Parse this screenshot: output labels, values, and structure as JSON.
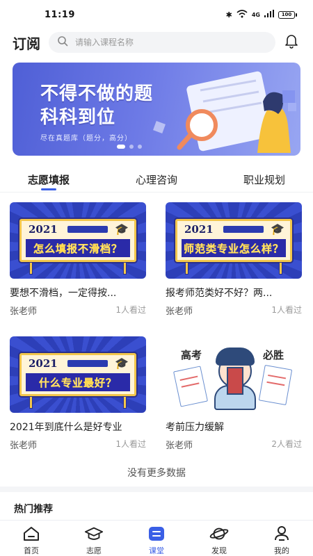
{
  "status": {
    "time": "11:19",
    "battery": "100",
    "signal": "4G"
  },
  "header": {
    "title": "订阅",
    "search_placeholder": "请输入课程名称"
  },
  "banner": {
    "line1": "不得不做的题",
    "line2": "科科到位",
    "subtitle": "尽在真题库（题分，高分）"
  },
  "tabs": [
    {
      "label": "志愿填报",
      "active": true
    },
    {
      "label": "心理咨询",
      "active": false
    },
    {
      "label": "职业规划",
      "active": false
    }
  ],
  "cards": [
    {
      "sign_year": "2021",
      "sign_text": "怎么填报不滑档？",
      "title": "要想不滑档，一定得按...",
      "teacher": "张老师",
      "views": "1人看过"
    },
    {
      "sign_year": "2021",
      "sign_text": "师范类专业怎么样？",
      "title": "报考师范类好不好？两...",
      "teacher": "张老师",
      "views": "1人看过"
    },
    {
      "sign_year": "2021",
      "sign_text": "什么专业最好？",
      "title": "2021年到底什么是好专业",
      "teacher": "张老师",
      "views": "1人看过"
    },
    {
      "art_left": "高考",
      "art_right": "必胜",
      "title": "考前压力缓解",
      "teacher": "张老师",
      "views": "2人看过"
    }
  ],
  "no_more": "没有更多数据",
  "hot_title": "热门推荐",
  "nav": [
    {
      "label": "首页",
      "icon": "home-icon",
      "active": false
    },
    {
      "label": "志愿",
      "icon": "graduation-cap-icon",
      "active": false
    },
    {
      "label": "课堂",
      "icon": "classroom-icon",
      "active": true
    },
    {
      "label": "发现",
      "icon": "planet-icon",
      "active": false
    },
    {
      "label": "我的",
      "icon": "profile-icon",
      "active": false
    }
  ],
  "colors": {
    "accent": "#3a5fe6",
    "banner": "#5a68dc",
    "sign_border": "#f2c64b"
  }
}
